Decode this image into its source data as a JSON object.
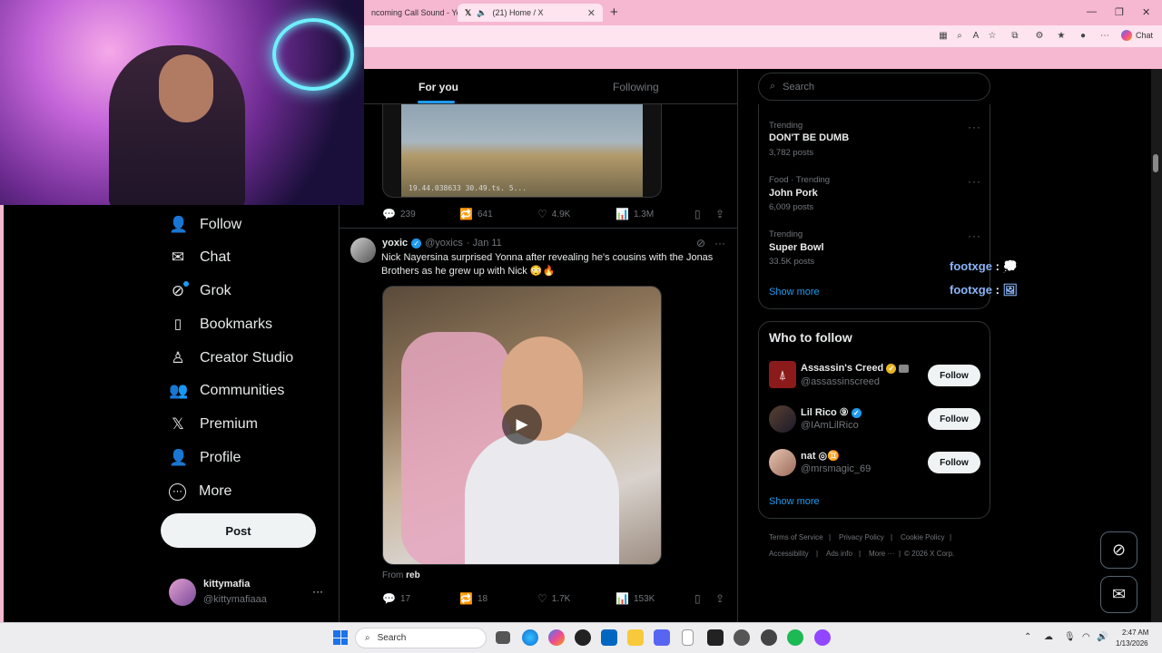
{
  "browser": {
    "tabs": [
      {
        "title": "ncoming Call Sound - Yo"
      },
      {
        "title": "(21) Home / X"
      }
    ],
    "new_tab_symbol": "+",
    "window_controls": [
      "—",
      "❐",
      "✕"
    ],
    "chat_button_label": "Chat"
  },
  "sidebar": {
    "items": [
      {
        "label": "Follow",
        "icon": "person-plus-icon",
        "glyph": "👤"
      },
      {
        "label": "Chat",
        "icon": "envelope-icon",
        "glyph": "✉"
      },
      {
        "label": "Grok",
        "icon": "grok-icon",
        "glyph": "⊘"
      },
      {
        "label": "Bookmarks",
        "icon": "bookmark-icon",
        "glyph": "🔖"
      },
      {
        "label": "Creator Studio",
        "icon": "creator-studio-icon",
        "glyph": "♙"
      },
      {
        "label": "Communities",
        "icon": "communities-icon",
        "glyph": "👥"
      },
      {
        "label": "Premium",
        "icon": "x-logo-icon",
        "glyph": "𝕏"
      },
      {
        "label": "Profile",
        "icon": "person-icon",
        "glyph": "👤"
      },
      {
        "label": "More",
        "icon": "more-circle-icon",
        "glyph": "⋯"
      }
    ],
    "post_label": "Post",
    "account": {
      "name": "kittymafia",
      "handle": "@kittymafiaaa",
      "more": "···"
    }
  },
  "feed": {
    "tabs": {
      "for_you": "For you",
      "following": "Following"
    },
    "tweet1": {
      "media_overlay_text": "19.44.038633  30.49.ts. 5...",
      "replies": "239",
      "reposts": "641",
      "likes": "4.9K",
      "views": "1.3M"
    },
    "tweet2": {
      "author_name": "yoxic",
      "author_handle": "@yoxics",
      "date": "· Jan 11",
      "text": "Nick Nayersina surprised Yonna after revealing he's cousins with the Jonas Brothers as he grew up with Nick 😳🔥",
      "from_label": "From",
      "from_source": "reb",
      "replies": "17",
      "reposts": "18",
      "likes": "1.7K",
      "views": "153K"
    }
  },
  "right": {
    "search_placeholder": "Search",
    "trends": [
      {
        "meta": "Trending",
        "name": "DON'T BE DUMB",
        "count": "3,782 posts"
      },
      {
        "meta": "Food · Trending",
        "name": "John Pork",
        "count": "6,009 posts"
      },
      {
        "meta": "Trending",
        "name": "Super Bowl",
        "count": "33.5K posts"
      }
    ],
    "show_more": "Show more",
    "who_to_follow_title": "Who to follow",
    "who_to_follow": [
      {
        "name": "Assassin's Creed",
        "handle": "@assassinscreed",
        "button": "Follow"
      },
      {
        "name": "Lil Rico ⑨",
        "handle": "@IAmLilRico",
        "button": "Follow"
      },
      {
        "name": "nat ◎♊",
        "handle": "@mrsmagic_69",
        "button": "Follow"
      }
    ],
    "show_more_2": "Show more",
    "footer": [
      "Terms of Service",
      "Privacy Policy",
      "Cookie Policy",
      "Accessibility",
      "Ads info",
      "More ···",
      "© 2026 X Corp."
    ]
  },
  "stream_overlay": [
    {
      "user": "footxge",
      "sep": ":",
      "emote": "💭"
    },
    {
      "user": "footxge",
      "sep": ":",
      "emote": "🖼"
    }
  ],
  "taskbar": {
    "search_label": "Search",
    "time": "2:47 AM",
    "date": "1/13/2026"
  }
}
